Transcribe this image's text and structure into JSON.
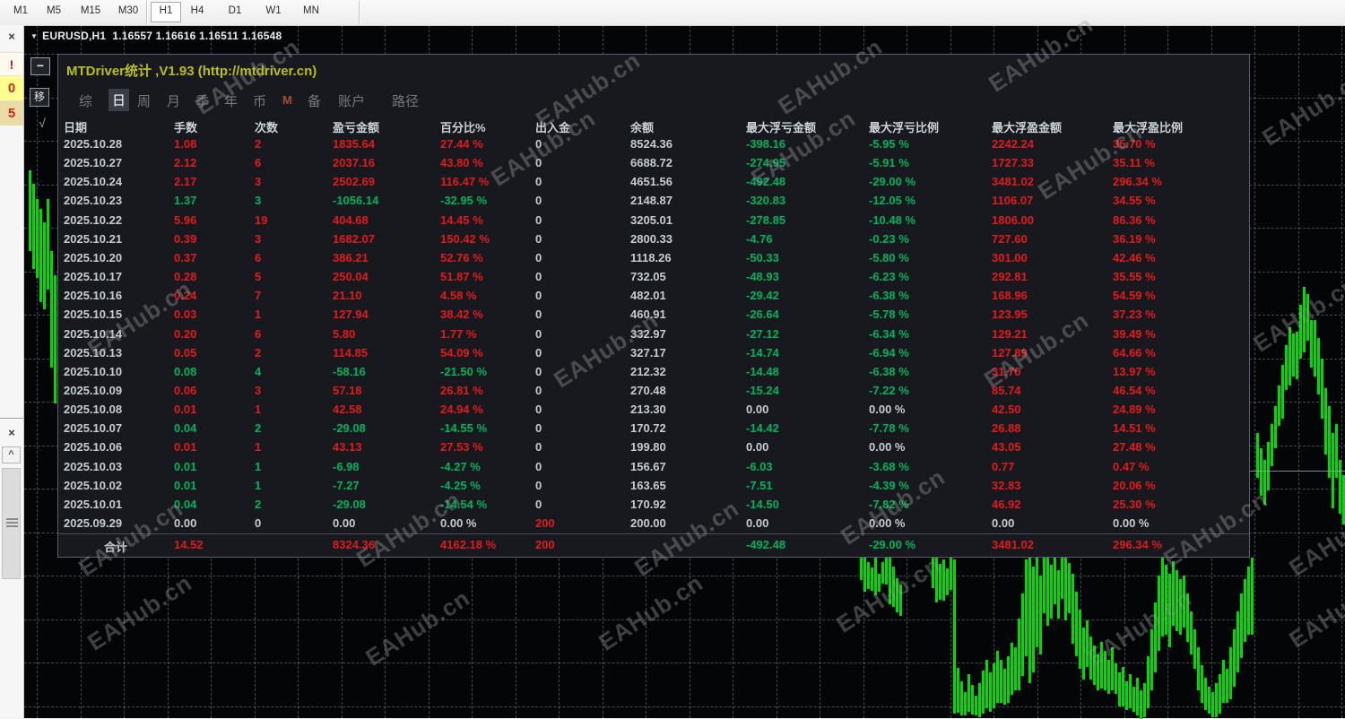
{
  "toolbar": {
    "timeframes": [
      {
        "label": "M1",
        "active": false
      },
      {
        "label": "M5",
        "active": false
      },
      {
        "label": "M15",
        "active": false
      },
      {
        "label": "M30",
        "active": false
      },
      {
        "label": "H1",
        "active": true
      },
      {
        "label": "H4",
        "active": false
      },
      {
        "label": "D1",
        "active": false
      },
      {
        "label": "W1",
        "active": false
      },
      {
        "label": "MN",
        "active": false
      }
    ]
  },
  "left_strip": {
    "close_top": "×",
    "alert": "!",
    "badge_zero": "0",
    "badge_five": "5",
    "close_bottom": "×",
    "collapse_up": "^"
  },
  "chart": {
    "dropdown_arrow": "▼",
    "symbol": "EURUSD,H1",
    "ohlc": "1.16557 1.16616 1.16511 1.16548"
  },
  "panel": {
    "title": "MTDriver统计 ,V1.93 (http://mtdriver.cn)",
    "controls": {
      "minimize": "−",
      "move": "移",
      "check": "√"
    },
    "tabs": [
      {
        "label": "综",
        "active": false,
        "accent": false
      },
      {
        "label": "日",
        "active": true,
        "accent": false
      },
      {
        "label": "周",
        "active": false,
        "accent": false
      },
      {
        "label": "月",
        "active": false,
        "accent": false
      },
      {
        "label": "季",
        "active": false,
        "accent": false
      },
      {
        "label": "年",
        "active": false,
        "accent": false
      },
      {
        "label": "币",
        "active": false,
        "accent": false
      },
      {
        "label": "M",
        "active": false,
        "accent": true
      },
      {
        "label": "备",
        "active": false,
        "accent": false
      },
      {
        "label": "账户",
        "active": false,
        "accent": false
      },
      {
        "label": "路径",
        "active": false,
        "accent": false
      }
    ],
    "table": {
      "headers": [
        "日期",
        "手数",
        "次数",
        "盈亏金额",
        "百分比%",
        "出入金",
        "余额",
        "最大浮亏金额",
        "最大浮亏比例",
        "最大浮盈金额",
        "最大浮盈比例"
      ],
      "rows": [
        [
          "2025.10.28",
          "1.08",
          "2",
          "1835.64",
          "27.44 %",
          "0",
          "8524.36",
          "-398.16",
          "-5.95 %",
          "2242.24",
          "35.70 %"
        ],
        [
          "2025.10.27",
          "2.12",
          "6",
          "2037.16",
          "43.80 %",
          "0",
          "6688.72",
          "-274.95",
          "-5.91 %",
          "1727.33",
          "35.11 %"
        ],
        [
          "2025.10.24",
          "2.17",
          "3",
          "2502.69",
          "116.47 %",
          "0",
          "4651.56",
          "-492.48",
          "-29.00 %",
          "3481.02",
          "296.34 %"
        ],
        [
          "2025.10.23",
          "1.37",
          "3",
          "-1056.14",
          "-32.95 %",
          "0",
          "2148.87",
          "-320.83",
          "-12.05 %",
          "1106.07",
          "34.55 %"
        ],
        [
          "2025.10.22",
          "5.96",
          "19",
          "404.68",
          "14.45 %",
          "0",
          "3205.01",
          "-278.85",
          "-10.48 %",
          "1806.00",
          "86.36 %"
        ],
        [
          "2025.10.21",
          "0.39",
          "3",
          "1682.07",
          "150.42 %",
          "0",
          "2800.33",
          "-4.76",
          "-0.23 %",
          "727.60",
          "36.19 %"
        ],
        [
          "2025.10.20",
          "0.37",
          "6",
          "386.21",
          "52.76 %",
          "0",
          "1118.26",
          "-50.33",
          "-5.80 %",
          "301.00",
          "42.46 %"
        ],
        [
          "2025.10.17",
          "0.28",
          "5",
          "250.04",
          "51.87 %",
          "0",
          "732.05",
          "-48.93",
          "-6.23 %",
          "292.81",
          "35.55 %"
        ],
        [
          "2025.10.16",
          "0.24",
          "7",
          "21.10",
          "4.58 %",
          "0",
          "482.01",
          "-29.42",
          "-6.38 %",
          "168.96",
          "54.59 %"
        ],
        [
          "2025.10.15",
          "0.03",
          "1",
          "127.94",
          "38.42 %",
          "0",
          "460.91",
          "-26.64",
          "-5.78 %",
          "123.95",
          "37.23 %"
        ],
        [
          "2025.10.14",
          "0.20",
          "6",
          "5.80",
          "1.77 %",
          "0",
          "332.97",
          "-27.12",
          "-6.34 %",
          "129.21",
          "39.49 %"
        ],
        [
          "2025.10.13",
          "0.05",
          "2",
          "114.85",
          "54.09 %",
          "0",
          "327.17",
          "-14.74",
          "-6.94 %",
          "127.89",
          "64.66 %"
        ],
        [
          "2025.10.10",
          "0.08",
          "4",
          "-58.16",
          "-21.50 %",
          "0",
          "212.32",
          "-14.48",
          "-6.38 %",
          "31.70",
          "13.97 %"
        ],
        [
          "2025.10.09",
          "0.06",
          "3",
          "57.18",
          "26.81 %",
          "0",
          "270.48",
          "-15.24",
          "-7.22 %",
          "85.74",
          "46.54 %"
        ],
        [
          "2025.10.08",
          "0.01",
          "1",
          "42.58",
          "24.94 %",
          "0",
          "213.30",
          "0.00",
          "0.00 %",
          "42.50",
          "24.89 %"
        ],
        [
          "2025.10.07",
          "0.04",
          "2",
          "-29.08",
          "-14.55 %",
          "0",
          "170.72",
          "-14.42",
          "-7.78 %",
          "26.88",
          "14.51 %"
        ],
        [
          "2025.10.06",
          "0.01",
          "1",
          "43.13",
          "27.53 %",
          "0",
          "199.80",
          "0.00",
          "0.00 %",
          "43.05",
          "27.48 %"
        ],
        [
          "2025.10.03",
          "0.01",
          "1",
          "-6.98",
          "-4.27 %",
          "0",
          "156.67",
          "-6.03",
          "-3.68 %",
          "0.77",
          "0.47 %"
        ],
        [
          "2025.10.02",
          "0.01",
          "1",
          "-7.27",
          "-4.25 %",
          "0",
          "163.65",
          "-7.51",
          "-4.39 %",
          "32.83",
          "20.06 %"
        ],
        [
          "2025.10.01",
          "0.04",
          "2",
          "-29.08",
          "-14.54 %",
          "0",
          "170.92",
          "-14.50",
          "-7.82 %",
          "46.92",
          "25.30 %"
        ],
        [
          "2025.09.29",
          "0.00",
          "0",
          "0.00",
          "0.00 %",
          "200",
          "200.00",
          "0.00",
          "0.00 %",
          "0.00",
          "0.00 %"
        ]
      ],
      "total": [
        "合计",
        "14.52",
        "",
        "8324.36",
        "4162.18 %",
        "200",
        "",
        "-492.48",
        "-29.00 %",
        "3481.02",
        "296.34 %"
      ]
    }
  },
  "watermark": {
    "text": "EAHub.cn"
  },
  "colors": {
    "profit_red": "#e11b1b",
    "loss_green": "#00b35c",
    "neutral_text": "#c6ccd4",
    "title_yellow": "#bdbf10",
    "candle_green": "#00dc00"
  }
}
